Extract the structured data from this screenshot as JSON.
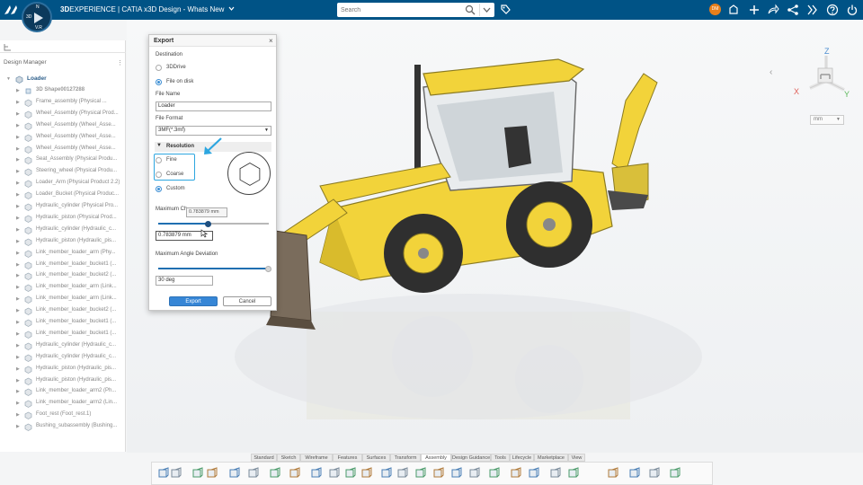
{
  "app": {
    "brand_prefix": "3D",
    "brand_experience": "EXPERIENCE",
    "brand_rest": " | CATIA  x3D Design - Whats New",
    "compass_n": "N",
    "compass_w": "3D",
    "compass_e": "V.R",
    "user_initials": "DM"
  },
  "search": {
    "placeholder": "Search"
  },
  "tree": {
    "panel_title": "Design Manager",
    "root": "Loader",
    "items": [
      "3D Shape00127288",
      "Frame_assembly (Physical ...",
      "Wheel_Assembly (Physical Prod...",
      "Wheel_Assembly (Wheel_Asse...",
      "Wheel_Assembly (Wheel_Asse...",
      "Wheel_Assembly (Wheel_Asse...",
      "Seat_Assembly (Physical Produ...",
      "Steering_wheel (Physical Produ...",
      "Loader_Arm (Physical Product 2.2)",
      "Loader_Bucket (Physical Produc...",
      "Hydraulic_cylinder (Physical Pro...",
      "Hydraulic_piston (Physical Prod...",
      "Hydraulic_cylinder (Hydraulic_c...",
      "Hydraulic_piston (Hydraulic_pis...",
      "Link_member_loader_arm (Phy...",
      "Link_member_loader_bucket1 (...",
      "Link_member_loader_bucket2 (...",
      "Link_member_loader_arm (Link...",
      "Link_member_loader_arm (Link...",
      "Link_member_loader_bucket2 (...",
      "Link_member_loader_bucket1 (...",
      "Link_member_loader_bucket1 (...",
      "Hydraulic_cylinder (Hydraulic_c...",
      "Hydraulic_cylinder (Hydraulic_c...",
      "Hydraulic_piston (Hydraulic_pis...",
      "Hydraulic_piston (Hydraulic_pis...",
      "Link_member_loader_arm2 (Ph...",
      "Link_member_loader_arm2 (Lin...",
      "Foot_rest (Foot_rest.1)",
      "Bushing_subassembly (Bushing..."
    ]
  },
  "dialog": {
    "title": "Export",
    "destination_label": "Destination",
    "dest_options": [
      "3DDrive",
      "File on disk"
    ],
    "dest_selected": "File on disk",
    "file_name_label": "File Name",
    "file_name_value": "Loader",
    "file_format_label": "File Format",
    "file_format_value": "3MF(*.3mf)",
    "resolution_label": "Resolution",
    "resolution_options": [
      "Fine",
      "Coarse",
      "Custom"
    ],
    "resolution_selected": "Custom",
    "max_chord_label": "Maximum Ch",
    "max_chord_tooltip": "0.783879 mm",
    "max_chord_value": "0.783879 mm",
    "max_chord_slider": 0.45,
    "max_angle_label": "Maximum Angle Deviation",
    "max_angle_value": "30 deg",
    "max_angle_slider": 1.0,
    "export_button": "Export",
    "cancel_button": "Cancel"
  },
  "viewport": {
    "unit": "mm",
    "axis_x": "X",
    "axis_y": "Y",
    "axis_z": "Z"
  },
  "action_tabs": [
    "Standard",
    "Sketch",
    "Wireframe",
    "Features",
    "Surfaces",
    "Transform",
    "Assembly",
    "Design Guidance",
    "Tools",
    "Lifecycle",
    "Marketplace",
    "View"
  ],
  "active_tab": "Assembly",
  "colors": {
    "topbar": "#005386",
    "accent": "#3686d6",
    "highlight": "#2da6e0",
    "machine_yellow": "#f2d33a",
    "avatar": "#e87f1b"
  }
}
